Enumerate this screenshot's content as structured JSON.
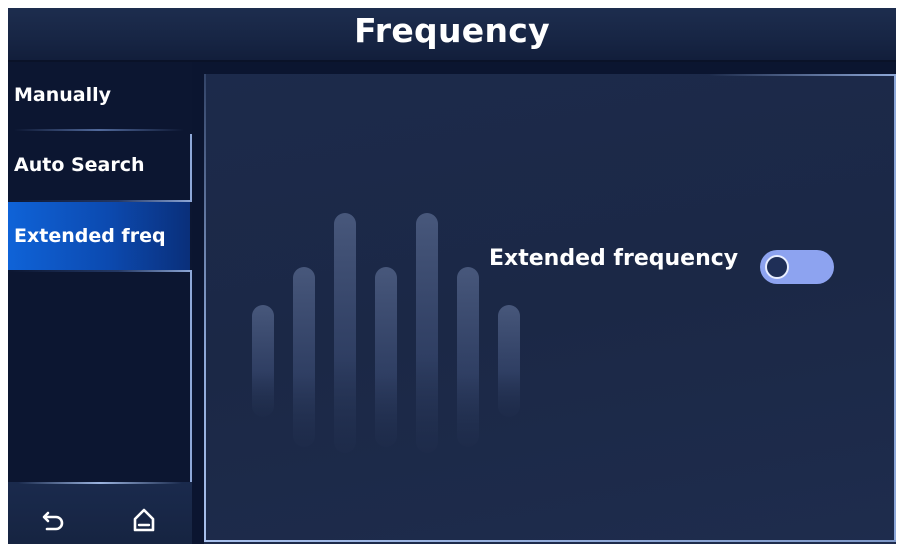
{
  "header": {
    "title": "Frequency"
  },
  "sidebar": {
    "items": [
      {
        "label": "Manually",
        "selected": false
      },
      {
        "label": "Auto Search",
        "selected": false
      },
      {
        "label": "Extended freq",
        "selected": true
      }
    ],
    "back_icon": "back-arrow-icon",
    "home_icon": "home-icon"
  },
  "main": {
    "setting_label": "Extended frequency",
    "toggle_state": "off",
    "decoration_icon": "equalizer-bars-icon"
  },
  "colors": {
    "accent": "#0f63d8",
    "toggle_track": "#8da3f0",
    "frame": "#8ea8d8"
  }
}
